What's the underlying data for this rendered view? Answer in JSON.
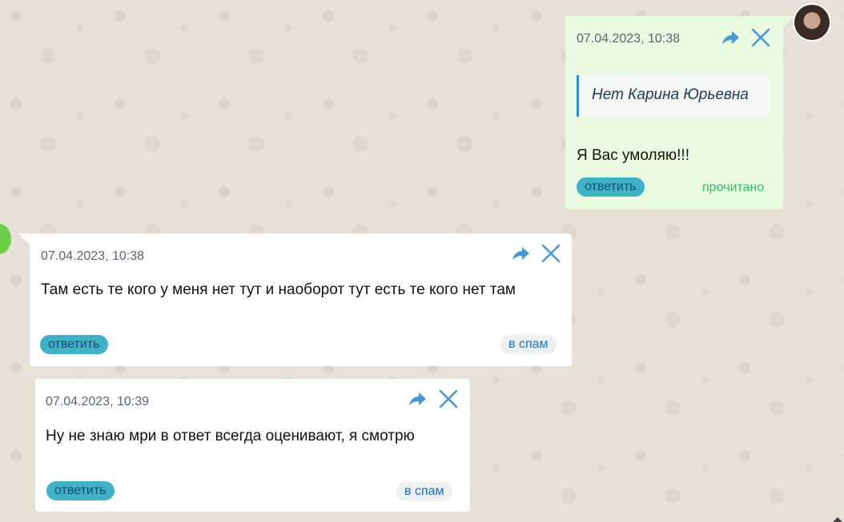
{
  "messages": [
    {
      "id": "m1",
      "date": "07.04.2023, 10:38",
      "quote": "Нет Карина Юрьевна",
      "text": "Я Вас умоляю!!!",
      "reply_label": "ответить",
      "status": "прочитано"
    },
    {
      "id": "m2",
      "date": "07.04.2023, 10:38",
      "text": "Там есть те кого у меня нет тут и наоборот тут есть те кого нет там",
      "reply_label": "ответить",
      "spam_label": "в спам"
    },
    {
      "id": "m3",
      "date": "07.04.2023, 10:39",
      "text": "Ну не знаю мри в ответ всегда оценивают, я смотрю",
      "reply_label": "ответить",
      "spam_label": "в спам"
    }
  ],
  "icons": {
    "forward": "forward-arrow-icon",
    "close": "close-icon"
  },
  "colors": {
    "own_bubble": "#eafbe1",
    "other_bubble": "#ffffff",
    "reply_button": "#3fb2c8",
    "spam_button": "#edf0f3",
    "read_status": "#2fbf65",
    "action_icon": "#4a97d6"
  }
}
